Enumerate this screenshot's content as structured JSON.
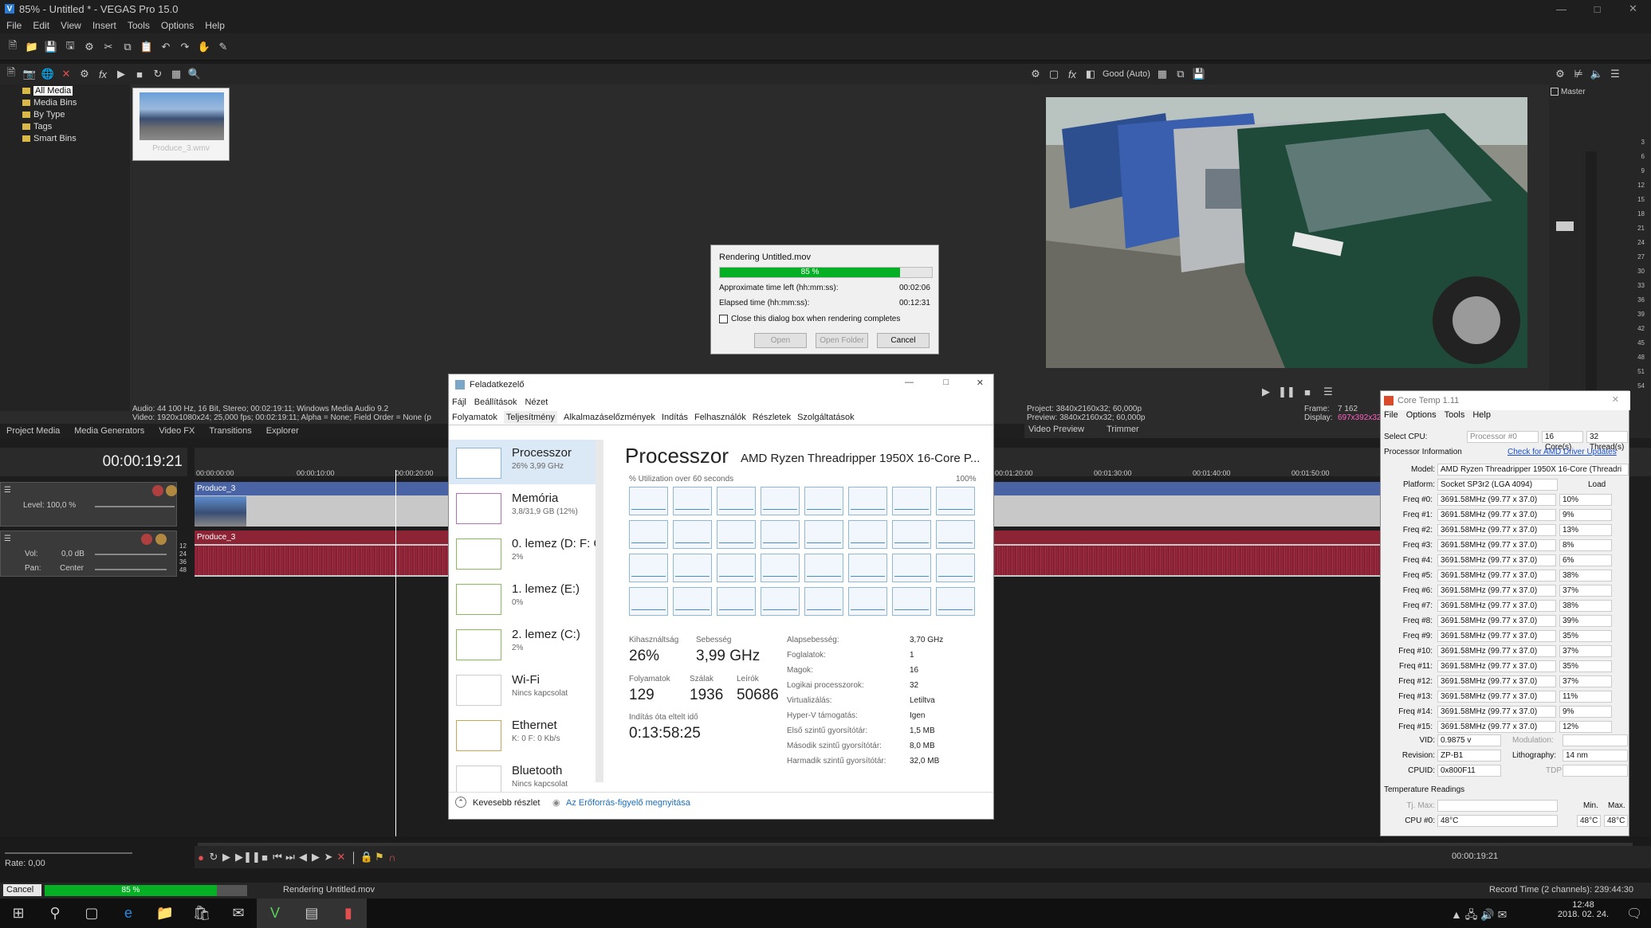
{
  "vegas": {
    "title": "85% - Untitled * - VEGAS Pro 15.0",
    "menu": [
      "File",
      "Edit",
      "View",
      "Insert",
      "Tools",
      "Options",
      "Help"
    ],
    "media_tree": [
      "All Media",
      "Media Bins",
      "By Type",
      "Tags",
      "Smart Bins"
    ],
    "thumbnail_caption": "Produce_3.wmv",
    "media_info_line1": "Audio: 44 100 Hz, 16 Bit, Stereo; 00:02:19:11; Windows Media Audio 9.2",
    "media_info_line2": "Video: 1920x1080x24; 25,000 fps; 00:02:19:11; Alpha = None; Field Order = None (p",
    "bottom_tabs": [
      "Project Media",
      "Media Generators",
      "Video FX",
      "Transitions",
      "Explorer"
    ],
    "preview_quality": "Good (Auto)",
    "preview_project": "Project:  3840x2160x32; 60,000p",
    "preview_preview": "Preview:  3840x2160x32; 60,000p",
    "preview_frame_label": "Frame:",
    "preview_frame_value": "7 162",
    "preview_display_label": "Display:",
    "preview_display_value": "697x392x32",
    "preview_tabs": [
      "Video Preview",
      "Trimmer"
    ],
    "master_label": "Master",
    "meter_scale": [
      "3",
      "6",
      "9",
      "12",
      "15",
      "18",
      "21",
      "24",
      "27",
      "30",
      "33",
      "36",
      "39",
      "42",
      "45",
      "48",
      "51",
      "54"
    ],
    "timecode": "00:00:19:21",
    "ruler_ticks": [
      "00:00:00:00",
      "00:00:10:00",
      "00:00:20:00",
      "00:01:20:00",
      "00:01:30:00",
      "00:01:40:00",
      "00:01:50:00"
    ],
    "video_track": {
      "clip": "Produce_3",
      "level": "Level: 100,0 %"
    },
    "audio_track": {
      "clip": "Produce_3",
      "vol_label": "Vol:",
      "vol_value": "0,0 dB",
      "pan_label": "Pan:",
      "pan_value": "Center",
      "db_ticks": [
        "12",
        "24",
        "36",
        "48"
      ]
    },
    "rate": "Rate: 0,00",
    "transport_time": "00:00:19:21",
    "status_cancel": "Cancel",
    "status_progress": "85 %",
    "status_text": "Rendering Untitled.mov",
    "status_record": "Record Time (2 channels): 239:44:30"
  },
  "render_dialog": {
    "title": "Rendering Untitled.mov",
    "progress_label": "85 %",
    "progress": 0.85,
    "time_left_label": "Approximate time left (hh:mm:ss):",
    "time_left": "00:02:06",
    "elapsed_label": "Elapsed time (hh:mm:ss):",
    "elapsed": "00:12:31",
    "close_checkbox": "Close this dialog box when rendering completes",
    "btn_open": "Open",
    "btn_open_folder": "Open Folder",
    "btn_cancel": "Cancel"
  },
  "taskmgr": {
    "title": "Feladatkezelő",
    "menu": [
      "Fájl",
      "Beállítások",
      "Nézet"
    ],
    "tabs": [
      "Folyamatok",
      "Teljesítmény",
      "Alkalmazáselőzmények",
      "Indítás",
      "Felhasználók",
      "Részletek",
      "Szolgáltatások"
    ],
    "side": [
      {
        "name": "Processzor",
        "sub": "26% 3,99 GHz"
      },
      {
        "name": "Memória",
        "sub": "3,8/31,9 GB (12%)"
      },
      {
        "name": "0. lemez (D: F: G",
        "sub": "2%"
      },
      {
        "name": "1. lemez (E:)",
        "sub": "0%"
      },
      {
        "name": "2. lemez (C:)",
        "sub": "2%"
      },
      {
        "name": "Wi-Fi",
        "sub": "Nincs kapcsolat"
      },
      {
        "name": "Ethernet",
        "sub": "K: 0  F: 0 Kb/s"
      },
      {
        "name": "Bluetooth",
        "sub": "Nincs kapcsolat"
      }
    ],
    "heading": "Processzor",
    "cpu_name": "AMD Ryzen Threadripper 1950X 16-Core P...",
    "util_label": "% Utilization over 60 seconds",
    "util_max": "100%",
    "stats": {
      "kihasznaltsag_label": "Kihasználtság",
      "kihasznaltsag": "26%",
      "sebesseg_label": "Sebesség",
      "sebesseg": "3,99 GHz",
      "folyamatok_label": "Folyamatok",
      "folyamatok": "129",
      "szalak_label": "Szálak",
      "szalak": "1936",
      "leirok_label": "Leírók",
      "leirok": "50686",
      "uptime_label": "Indítás óta eltelt idő",
      "uptime": "0:13:58:25"
    },
    "details": [
      {
        "k": "Alapsebesség:",
        "v": "3,70 GHz"
      },
      {
        "k": "Foglalatok:",
        "v": "1"
      },
      {
        "k": "Magok:",
        "v": "16"
      },
      {
        "k": "Logikai processzorok:",
        "v": "32"
      },
      {
        "k": "Virtualizálás:",
        "v": "Letiltva"
      },
      {
        "k": "Hyper-V támogatás:",
        "v": "Igen"
      },
      {
        "k": "Első szintű gyorsítótár:",
        "v": "1,5 MB"
      },
      {
        "k": "Második szintű gyorsítótár:",
        "v": "8,0 MB"
      },
      {
        "k": "Harmadik szintű gyorsítótár:",
        "v": "32,0 MB"
      }
    ],
    "fewer_details": "Kevesebb részlet",
    "resmon_link": "Az Erőforrás-figyelő megnyitása"
  },
  "coretemp": {
    "title": "Core Temp 1.11",
    "menu": [
      "File",
      "Options",
      "Tools",
      "Help"
    ],
    "select_cpu_label": "Select CPU:",
    "select_cpu_value": "Processor #0",
    "cores": "16  Core(s)",
    "threads": "32  Thread(s)",
    "proc_info": "Processor Information",
    "amd_link": "Check for AMD Driver Updates",
    "model_label": "Model:",
    "model": "AMD Ryzen Threadripper 1950X 16-Core (Threadri",
    "platform_label": "Platform:",
    "platform": "Socket SP3r2 (LGA 4094)",
    "load_label": "Load",
    "freqs": [
      {
        "k": "Freq #0:",
        "v": "3691.58MHz (99.77 x 37.0)",
        "l": "10%"
      },
      {
        "k": "Freq #1:",
        "v": "3691.58MHz (99.77 x 37.0)",
        "l": "9%"
      },
      {
        "k": "Freq #2:",
        "v": "3691.58MHz (99.77 x 37.0)",
        "l": "13%"
      },
      {
        "k": "Freq #3:",
        "v": "3691.58MHz (99.77 x 37.0)",
        "l": "8%"
      },
      {
        "k": "Freq #4:",
        "v": "3691.58MHz (99.77 x 37.0)",
        "l": "6%"
      },
      {
        "k": "Freq #5:",
        "v": "3691.58MHz (99.77 x 37.0)",
        "l": "38%"
      },
      {
        "k": "Freq #6:",
        "v": "3691.58MHz (99.77 x 37.0)",
        "l": "37%"
      },
      {
        "k": "Freq #7:",
        "v": "3691.58MHz (99.77 x 37.0)",
        "l": "38%"
      },
      {
        "k": "Freq #8:",
        "v": "3691.58MHz (99.77 x 37.0)",
        "l": "39%"
      },
      {
        "k": "Freq #9:",
        "v": "3691.58MHz (99.77 x 37.0)",
        "l": "35%"
      },
      {
        "k": "Freq #10:",
        "v": "3691.58MHz (99.77 x 37.0)",
        "l": "37%"
      },
      {
        "k": "Freq #11:",
        "v": "3691.58MHz (99.77 x 37.0)",
        "l": "35%"
      },
      {
        "k": "Freq #12:",
        "v": "3691.58MHz (99.77 x 37.0)",
        "l": "37%"
      },
      {
        "k": "Freq #13:",
        "v": "3691.58MHz (99.77 x 37.0)",
        "l": "11%"
      },
      {
        "k": "Freq #14:",
        "v": "3691.58MHz (99.77 x 37.0)",
        "l": "9%"
      },
      {
        "k": "Freq #15:",
        "v": "3691.58MHz (99.77 x 37.0)",
        "l": "12%"
      }
    ],
    "vid_label": "VID:",
    "vid": "0.9875 v",
    "modulation_label": "Modulation:",
    "revision_label": "Revision:",
    "revision": "ZP-B1",
    "lithography_label": "Lithography:",
    "lithography": "14 nm",
    "cpuid_label": "CPUID:",
    "cpuid": "0x800F11",
    "tdp_label": "TDP:",
    "temp_heading": "Temperature Readings",
    "tjmax_label": "Tj. Max:",
    "min_label": "Min.",
    "max_label": "Max.",
    "cpu0_label": "CPU #0:",
    "cpu0": "48°C",
    "cpu0_min": "48°C",
    "cpu0_max": "48°C"
  },
  "taskbar": {
    "time": "12:48",
    "date": "2018. 02. 24."
  },
  "colors": {
    "progress_green": "#06b025",
    "vegas_bg": "#2b2b2b",
    "video_track": "#4a63a4",
    "audio_track": "#8d2436"
  }
}
